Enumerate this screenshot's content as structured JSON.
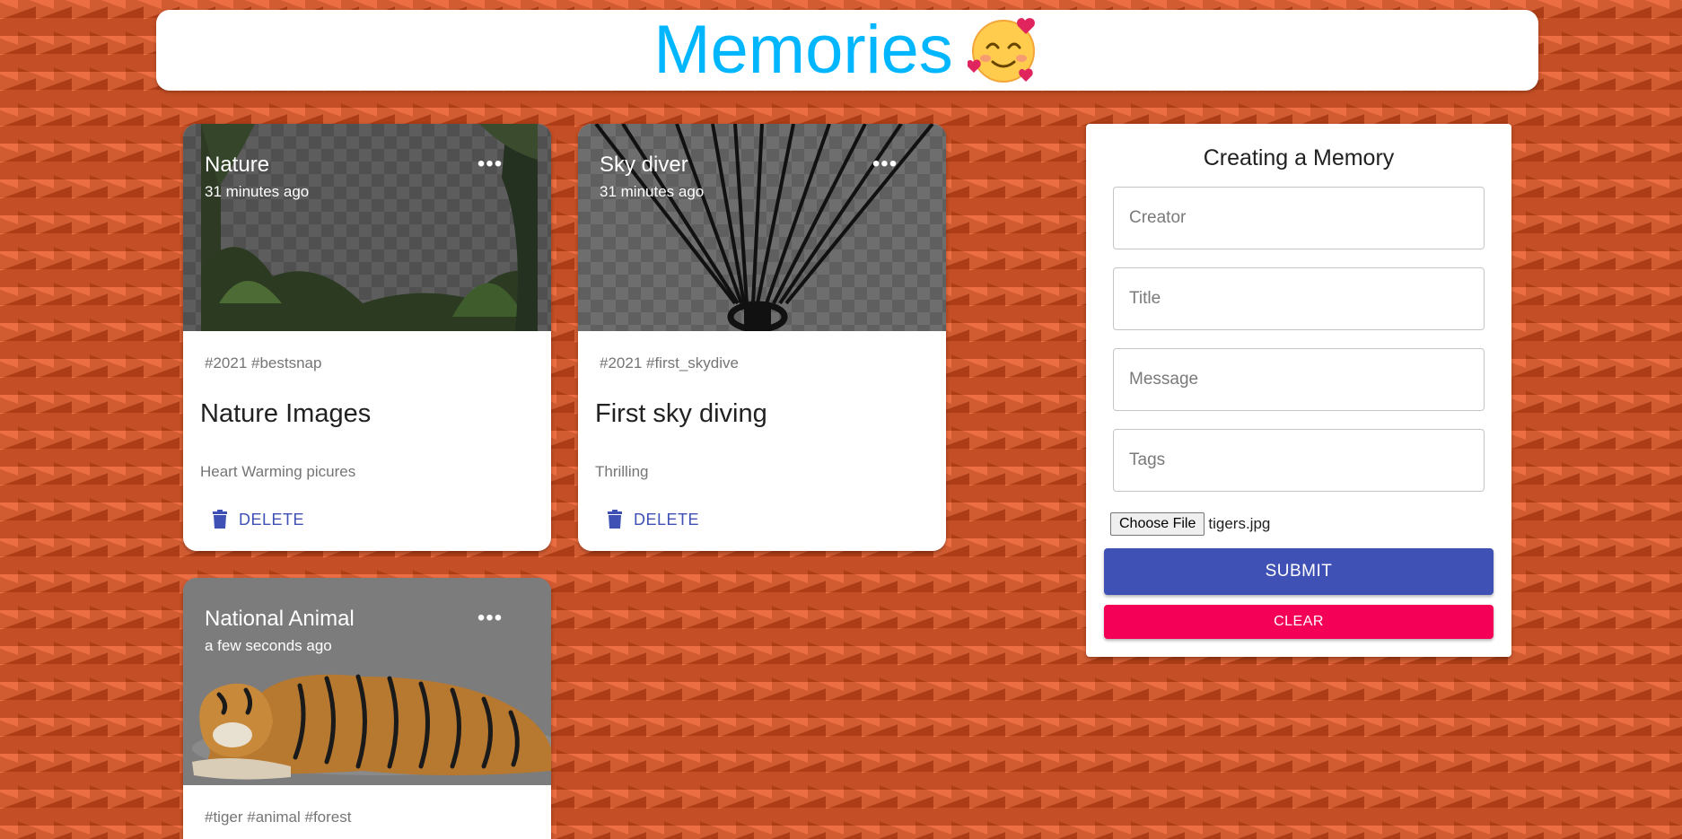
{
  "header": {
    "title": "Memories",
    "emoji_icon": "smiling-face-with-hearts-icon"
  },
  "posts": [
    {
      "creator": "Nature",
      "time": "31 minutes ago",
      "tags": "#2021 #bestsnap",
      "title": "Nature Images",
      "message": "Heart Warming picures",
      "delete_label": "DELETE",
      "more_label": "•••"
    },
    {
      "creator": "Sky diver",
      "time": "31 minutes ago",
      "tags": "#2021 #first_skydive",
      "title": "First sky diving",
      "message": "Thrilling",
      "delete_label": "DELETE",
      "more_label": "•••"
    },
    {
      "creator": "National Animal",
      "time": "a few seconds ago",
      "tags": "#tiger #animal #forest",
      "more_label": "•••"
    }
  ],
  "form": {
    "title": "Creating a Memory",
    "creator_placeholder": "Creator",
    "title_placeholder": "Title",
    "message_placeholder": "Message",
    "tags_placeholder": "Tags",
    "choose_file_label": "Choose File",
    "file_name": "tigers.jpg",
    "submit_label": "SUBMIT",
    "clear_label": "CLEAR"
  },
  "colors": {
    "background": "#e9531f",
    "title": "#00b7ff",
    "primary": "#3f51b5",
    "secondary": "#f50057"
  }
}
